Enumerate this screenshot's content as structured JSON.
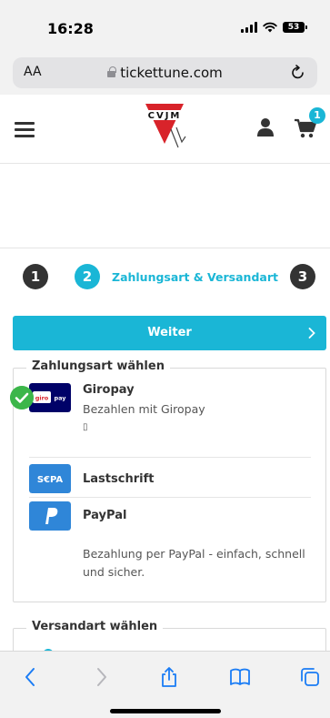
{
  "status_bar": {
    "time": "16:28",
    "battery": "53"
  },
  "browser": {
    "text_size_label": "AA",
    "url": "tickettune.com"
  },
  "header": {
    "logo_text": "CVJM",
    "cart_count": "1"
  },
  "checkout_steps": {
    "step1": "1",
    "step2": "2",
    "step2_label": "Zahlungsart & Versandart",
    "step3": "3"
  },
  "continue_button": {
    "label": "Weiter"
  },
  "payment_section": {
    "legend": "Zahlungsart wählen",
    "methods": [
      {
        "logo_text": "giro pay",
        "name": "Giropay",
        "description": "Bezahlen mit Giropay",
        "extra": "▯",
        "selected": true
      },
      {
        "logo_text": "SEPA",
        "name": "Lastschrift"
      },
      {
        "logo_text": "P",
        "name": "PayPal",
        "description": "Bezahlung per PayPal - einfach, schnell und sicher."
      }
    ]
  },
  "shipping_section": {
    "legend": "Versandart wählen"
  },
  "colors": {
    "accent": "#1ab6d6",
    "selected_check": "#3cb64a",
    "giropay_bg": "#000268",
    "sepa_bg": "#2f86d8",
    "paypal_bg": "#2f86d8"
  },
  "icons": {
    "menu": "hamburger-icon",
    "user": "user-icon",
    "cart": "cart-icon",
    "back": "back-arrow-icon",
    "forward": "forward-arrow-icon",
    "share": "share-icon",
    "bookmarks": "bookmarks-icon",
    "tabs": "tabs-icon"
  }
}
